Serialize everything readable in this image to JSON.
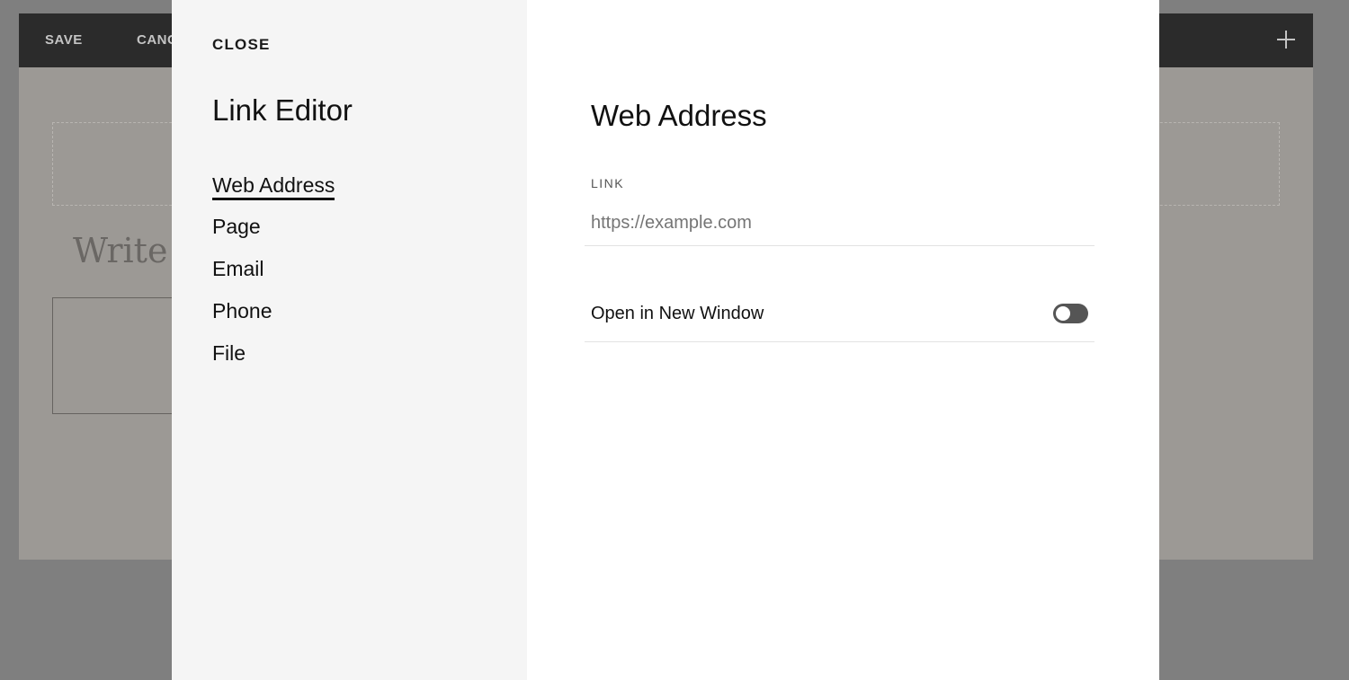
{
  "editor": {
    "save_label": "SAVE",
    "cancel_label": "CANCEL",
    "title_placeholder": "Write here..."
  },
  "modal": {
    "close_label": "CLOSE",
    "title": "Link Editor",
    "nav_items": [
      {
        "label": "Web Address",
        "active": true
      },
      {
        "label": "Page",
        "active": false
      },
      {
        "label": "Email",
        "active": false
      },
      {
        "label": "Phone",
        "active": false
      },
      {
        "label": "File",
        "active": false
      }
    ],
    "section_title": "Web Address",
    "link_field": {
      "label": "LINK",
      "value": "",
      "placeholder": "https://example.com"
    },
    "open_new_window": {
      "label": "Open in New Window",
      "enabled": false
    }
  },
  "icons": {
    "add": "plus-icon"
  },
  "colors": {
    "overlay": "#7f7f7f",
    "toolbar": "#2b2b2b",
    "sidebar": "#f5f5f5",
    "panel": "#ffffff",
    "toggle_off": "#555555"
  }
}
